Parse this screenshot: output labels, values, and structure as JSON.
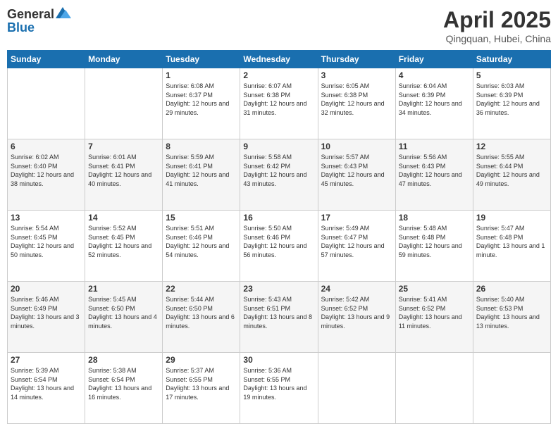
{
  "logo": {
    "line1": "General",
    "line2": "Blue"
  },
  "title": "April 2025",
  "location": "Qingquan, Hubei, China",
  "weekdays": [
    "Sunday",
    "Monday",
    "Tuesday",
    "Wednesday",
    "Thursday",
    "Friday",
    "Saturday"
  ],
  "weeks": [
    [
      {
        "day": "",
        "sunrise": "",
        "sunset": "",
        "daylight": ""
      },
      {
        "day": "",
        "sunrise": "",
        "sunset": "",
        "daylight": ""
      },
      {
        "day": "1",
        "sunrise": "Sunrise: 6:08 AM",
        "sunset": "Sunset: 6:37 PM",
        "daylight": "Daylight: 12 hours and 29 minutes."
      },
      {
        "day": "2",
        "sunrise": "Sunrise: 6:07 AM",
        "sunset": "Sunset: 6:38 PM",
        "daylight": "Daylight: 12 hours and 31 minutes."
      },
      {
        "day": "3",
        "sunrise": "Sunrise: 6:05 AM",
        "sunset": "Sunset: 6:38 PM",
        "daylight": "Daylight: 12 hours and 32 minutes."
      },
      {
        "day": "4",
        "sunrise": "Sunrise: 6:04 AM",
        "sunset": "Sunset: 6:39 PM",
        "daylight": "Daylight: 12 hours and 34 minutes."
      },
      {
        "day": "5",
        "sunrise": "Sunrise: 6:03 AM",
        "sunset": "Sunset: 6:39 PM",
        "daylight": "Daylight: 12 hours and 36 minutes."
      }
    ],
    [
      {
        "day": "6",
        "sunrise": "Sunrise: 6:02 AM",
        "sunset": "Sunset: 6:40 PM",
        "daylight": "Daylight: 12 hours and 38 minutes."
      },
      {
        "day": "7",
        "sunrise": "Sunrise: 6:01 AM",
        "sunset": "Sunset: 6:41 PM",
        "daylight": "Daylight: 12 hours and 40 minutes."
      },
      {
        "day": "8",
        "sunrise": "Sunrise: 5:59 AM",
        "sunset": "Sunset: 6:41 PM",
        "daylight": "Daylight: 12 hours and 41 minutes."
      },
      {
        "day": "9",
        "sunrise": "Sunrise: 5:58 AM",
        "sunset": "Sunset: 6:42 PM",
        "daylight": "Daylight: 12 hours and 43 minutes."
      },
      {
        "day": "10",
        "sunrise": "Sunrise: 5:57 AM",
        "sunset": "Sunset: 6:43 PM",
        "daylight": "Daylight: 12 hours and 45 minutes."
      },
      {
        "day": "11",
        "sunrise": "Sunrise: 5:56 AM",
        "sunset": "Sunset: 6:43 PM",
        "daylight": "Daylight: 12 hours and 47 minutes."
      },
      {
        "day": "12",
        "sunrise": "Sunrise: 5:55 AM",
        "sunset": "Sunset: 6:44 PM",
        "daylight": "Daylight: 12 hours and 49 minutes."
      }
    ],
    [
      {
        "day": "13",
        "sunrise": "Sunrise: 5:54 AM",
        "sunset": "Sunset: 6:45 PM",
        "daylight": "Daylight: 12 hours and 50 minutes."
      },
      {
        "day": "14",
        "sunrise": "Sunrise: 5:52 AM",
        "sunset": "Sunset: 6:45 PM",
        "daylight": "Daylight: 12 hours and 52 minutes."
      },
      {
        "day": "15",
        "sunrise": "Sunrise: 5:51 AM",
        "sunset": "Sunset: 6:46 PM",
        "daylight": "Daylight: 12 hours and 54 minutes."
      },
      {
        "day": "16",
        "sunrise": "Sunrise: 5:50 AM",
        "sunset": "Sunset: 6:46 PM",
        "daylight": "Daylight: 12 hours and 56 minutes."
      },
      {
        "day": "17",
        "sunrise": "Sunrise: 5:49 AM",
        "sunset": "Sunset: 6:47 PM",
        "daylight": "Daylight: 12 hours and 57 minutes."
      },
      {
        "day": "18",
        "sunrise": "Sunrise: 5:48 AM",
        "sunset": "Sunset: 6:48 PM",
        "daylight": "Daylight: 12 hours and 59 minutes."
      },
      {
        "day": "19",
        "sunrise": "Sunrise: 5:47 AM",
        "sunset": "Sunset: 6:48 PM",
        "daylight": "Daylight: 13 hours and 1 minute."
      }
    ],
    [
      {
        "day": "20",
        "sunrise": "Sunrise: 5:46 AM",
        "sunset": "Sunset: 6:49 PM",
        "daylight": "Daylight: 13 hours and 3 minutes."
      },
      {
        "day": "21",
        "sunrise": "Sunrise: 5:45 AM",
        "sunset": "Sunset: 6:50 PM",
        "daylight": "Daylight: 13 hours and 4 minutes."
      },
      {
        "day": "22",
        "sunrise": "Sunrise: 5:44 AM",
        "sunset": "Sunset: 6:50 PM",
        "daylight": "Daylight: 13 hours and 6 minutes."
      },
      {
        "day": "23",
        "sunrise": "Sunrise: 5:43 AM",
        "sunset": "Sunset: 6:51 PM",
        "daylight": "Daylight: 13 hours and 8 minutes."
      },
      {
        "day": "24",
        "sunrise": "Sunrise: 5:42 AM",
        "sunset": "Sunset: 6:52 PM",
        "daylight": "Daylight: 13 hours and 9 minutes."
      },
      {
        "day": "25",
        "sunrise": "Sunrise: 5:41 AM",
        "sunset": "Sunset: 6:52 PM",
        "daylight": "Daylight: 13 hours and 11 minutes."
      },
      {
        "day": "26",
        "sunrise": "Sunrise: 5:40 AM",
        "sunset": "Sunset: 6:53 PM",
        "daylight": "Daylight: 13 hours and 13 minutes."
      }
    ],
    [
      {
        "day": "27",
        "sunrise": "Sunrise: 5:39 AM",
        "sunset": "Sunset: 6:54 PM",
        "daylight": "Daylight: 13 hours and 14 minutes."
      },
      {
        "day": "28",
        "sunrise": "Sunrise: 5:38 AM",
        "sunset": "Sunset: 6:54 PM",
        "daylight": "Daylight: 13 hours and 16 minutes."
      },
      {
        "day": "29",
        "sunrise": "Sunrise: 5:37 AM",
        "sunset": "Sunset: 6:55 PM",
        "daylight": "Daylight: 13 hours and 17 minutes."
      },
      {
        "day": "30",
        "sunrise": "Sunrise: 5:36 AM",
        "sunset": "Sunset: 6:55 PM",
        "daylight": "Daylight: 13 hours and 19 minutes."
      },
      {
        "day": "",
        "sunrise": "",
        "sunset": "",
        "daylight": ""
      },
      {
        "day": "",
        "sunrise": "",
        "sunset": "",
        "daylight": ""
      },
      {
        "day": "",
        "sunrise": "",
        "sunset": "",
        "daylight": ""
      }
    ]
  ]
}
